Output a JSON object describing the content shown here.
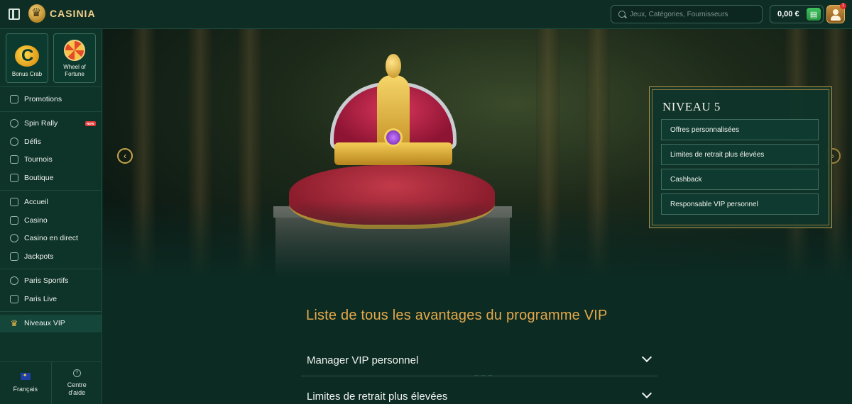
{
  "header": {
    "brand": "CASINIA",
    "search_placeholder": "Jeux, Catégories, Fournisseurs",
    "balance": "0,00 €",
    "notification_count": "1"
  },
  "sidebar": {
    "tiles": [
      {
        "label": "Bonus Crab"
      },
      {
        "label": "Wheel of Fortune"
      }
    ],
    "groups": [
      [
        {
          "label": "Promotions",
          "icon": "ticket-icon"
        }
      ],
      [
        {
          "label": "Spin Rally",
          "icon": "rocket-icon",
          "badge": "NEW"
        },
        {
          "label": "Défis",
          "icon": "target-icon"
        },
        {
          "label": "Tournois",
          "icon": "trophy-icon"
        },
        {
          "label": "Boutique",
          "icon": "shop-icon"
        }
      ],
      [
        {
          "label": "Accueil",
          "icon": "home-icon"
        },
        {
          "label": "Casino",
          "icon": "slot-icon"
        },
        {
          "label": "Casino en direct",
          "icon": "chip-icon"
        },
        {
          "label": "Jackpots",
          "icon": "seven-icon"
        }
      ],
      [
        {
          "label": "Paris Sportifs",
          "icon": "ball-icon"
        },
        {
          "label": "Paris Live",
          "icon": "live-icon"
        }
      ],
      [
        {
          "label": "Niveaux VIP",
          "icon": "crown-icon"
        }
      ]
    ],
    "footer": {
      "language": "Français",
      "help": "Centre d'aide"
    }
  },
  "hero": {
    "level_title": "NIVEAU 5",
    "perks": [
      "Offres personnalisées",
      "Limites de retrait plus élevées",
      "Cashback",
      "Responsable VIP personnel"
    ]
  },
  "benefits": {
    "title": "Liste de tous les avantages du programme VIP",
    "items": [
      "Manager VIP personnel",
      "Limites de retrait plus élevées"
    ]
  }
}
